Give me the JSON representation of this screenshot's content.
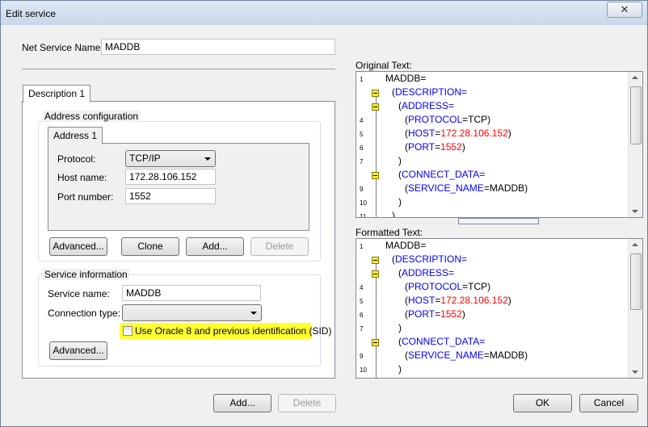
{
  "window": {
    "title": "Edit service",
    "close_glyph": "✕"
  },
  "net_service": {
    "label": "Net Service Name:",
    "value": "MADDB"
  },
  "tabs": [
    {
      "label": "Description 1"
    }
  ],
  "address_config": {
    "title": "Address configuration",
    "tab_label": "Address 1",
    "protocol_label": "Protocol:",
    "protocol_value": "TCP/IP",
    "host_label": "Host name:",
    "host_value": "172.28.106.152",
    "port_label": "Port number:",
    "port_value": "1552",
    "buttons": {
      "advanced": "Advanced...",
      "clone": "Clone",
      "add": "Add...",
      "delete": "Delete"
    }
  },
  "service_info": {
    "title": "Service information",
    "service_name_label": "Service name:",
    "service_name_value": "MADDB",
    "connection_type_label": "Connection type:",
    "connection_type_value": "",
    "sid_checkbox_label": "Use Oracle 8 and previous identification (SID)",
    "sid_checked": false,
    "advanced_label": "Advanced..."
  },
  "bottom_buttons": {
    "add": "Add...",
    "delete": "Delete",
    "ok": "OK",
    "cancel": "Cancel"
  },
  "original_text": {
    "label": "Original Text:",
    "line_numbers": [
      "1",
      "4",
      "5",
      "6",
      "7",
      "9",
      "10",
      "11"
    ],
    "lines": [
      {
        "parts": [
          {
            "t": "MADDB=",
            "c": "plain"
          }
        ]
      },
      {
        "parts": [
          {
            "t": "(",
            "c": "plain"
          },
          {
            "t": "DESCRIPTION",
            "c": "kw"
          },
          {
            "t": "=",
            "c": "kw"
          }
        ]
      },
      {
        "parts": [
          {
            "t": "(",
            "c": "plain"
          },
          {
            "t": "ADDRESS",
            "c": "kw"
          },
          {
            "t": "=",
            "c": "kw"
          }
        ]
      },
      {
        "parts": [
          {
            "t": "(",
            "c": "plain"
          },
          {
            "t": "PROTOCOL",
            "c": "kw"
          },
          {
            "t": "=TCP)",
            "c": "plain"
          }
        ]
      },
      {
        "parts": [
          {
            "t": "(",
            "c": "plain"
          },
          {
            "t": "HOST",
            "c": "kw"
          },
          {
            "t": "=",
            "c": "plain"
          },
          {
            "t": "172.28.106.152",
            "c": "val"
          },
          {
            "t": ")",
            "c": "plain"
          }
        ]
      },
      {
        "parts": [
          {
            "t": "(",
            "c": "plain"
          },
          {
            "t": "PORT",
            "c": "kw"
          },
          {
            "t": "=",
            "c": "plain"
          },
          {
            "t": "1552",
            "c": "val"
          },
          {
            "t": ")",
            "c": "plain"
          }
        ]
      },
      {
        "parts": [
          {
            "t": ")",
            "c": "plain"
          }
        ]
      },
      {
        "parts": [
          {
            "t": "(",
            "c": "plain"
          },
          {
            "t": "CONNECT_DATA",
            "c": "kw"
          },
          {
            "t": "=",
            "c": "kw"
          }
        ]
      },
      {
        "parts": [
          {
            "t": "(",
            "c": "plain"
          },
          {
            "t": "SERVICE_NAME",
            "c": "kw"
          },
          {
            "t": "=MADDB)",
            "c": "plain"
          }
        ]
      },
      {
        "parts": [
          {
            "t": ")",
            "c": "plain"
          }
        ]
      },
      {
        "parts": [
          {
            "t": ")",
            "c": "plain"
          }
        ]
      }
    ]
  },
  "formatted_text": {
    "label": "Formatted Text:",
    "line_numbers": [
      "1",
      "4",
      "5",
      "6",
      "7",
      "9",
      "10"
    ],
    "lines": [
      {
        "parts": [
          {
            "t": "MADDB=",
            "c": "plain"
          }
        ]
      },
      {
        "parts": [
          {
            "t": "(",
            "c": "plain"
          },
          {
            "t": "DESCRIPTION",
            "c": "kw"
          },
          {
            "t": "=",
            "c": "kw"
          }
        ]
      },
      {
        "parts": [
          {
            "t": "(",
            "c": "plain"
          },
          {
            "t": "ADDRESS",
            "c": "kw"
          },
          {
            "t": "=",
            "c": "kw"
          }
        ]
      },
      {
        "parts": [
          {
            "t": "(",
            "c": "plain"
          },
          {
            "t": "PROTOCOL",
            "c": "kw"
          },
          {
            "t": "=TCP)",
            "c": "plain"
          }
        ]
      },
      {
        "parts": [
          {
            "t": "(",
            "c": "plain"
          },
          {
            "t": "HOST",
            "c": "kw"
          },
          {
            "t": "=",
            "c": "plain"
          },
          {
            "t": "172.28.106.152",
            "c": "val"
          },
          {
            "t": ")",
            "c": "plain"
          }
        ]
      },
      {
        "parts": [
          {
            "t": "(",
            "c": "plain"
          },
          {
            "t": "PORT",
            "c": "kw"
          },
          {
            "t": "=",
            "c": "plain"
          },
          {
            "t": "1552",
            "c": "val"
          },
          {
            "t": ")",
            "c": "plain"
          }
        ]
      },
      {
        "parts": [
          {
            "t": ")",
            "c": "plain"
          }
        ]
      },
      {
        "parts": [
          {
            "t": "(",
            "c": "plain"
          },
          {
            "t": "CONNECT_DATA",
            "c": "kw"
          },
          {
            "t": "=",
            "c": "kw"
          }
        ]
      },
      {
        "parts": [
          {
            "t": "(",
            "c": "plain"
          },
          {
            "t": "SERVICE_NAME",
            "c": "kw"
          },
          {
            "t": "=MADDB)",
            "c": "plain"
          }
        ]
      },
      {
        "parts": [
          {
            "t": ")",
            "c": "plain"
          }
        ]
      }
    ]
  },
  "colors": {
    "keyword": "#0000ff",
    "value": "#ff0000",
    "highlight": "#ffff2d",
    "fold_marker": "#ffec3a"
  }
}
